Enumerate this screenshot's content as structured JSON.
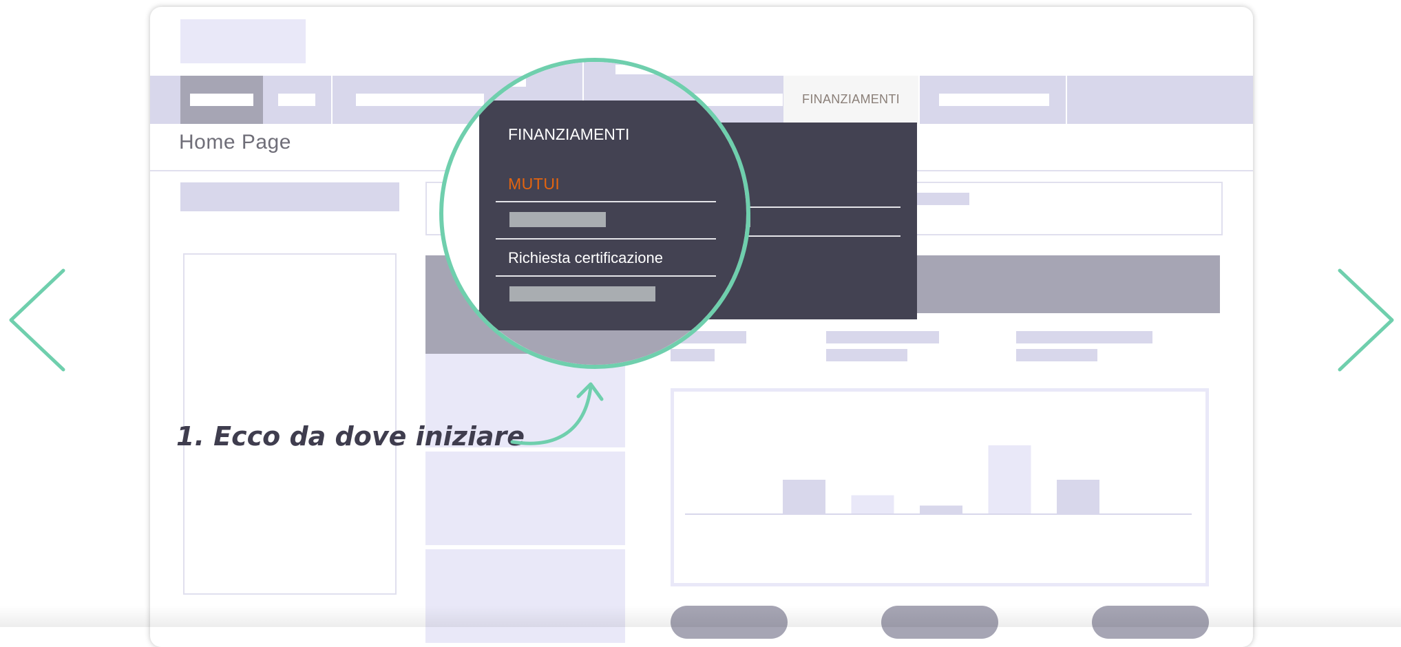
{
  "breadcrumb": {
    "title": "Home Page"
  },
  "nav": {
    "active_tab_label": "FINANZIAMENTI"
  },
  "mega_menu": {
    "heading": "FINANZIAMENTI",
    "items": [
      {
        "label": "MUTUI",
        "state": "highlighted"
      },
      {
        "label": ""
      },
      {
        "label": "Richiesta certificazione"
      },
      {
        "label": ""
      }
    ]
  },
  "callout": {
    "text": "1. Ecco da dove iniziare"
  },
  "chart_data": {
    "type": "bar",
    "categories": [
      "",
      "",
      "",
      "",
      ""
    ],
    "values": [
      2,
      1.1,
      0.5,
      4,
      2
    ]
  },
  "colors": {
    "accent_teal": "#6fcfad",
    "menu_dark": "#434252",
    "highlight_orange": "#e4640f",
    "placeholder_lavender": "#d8d7eb",
    "placeholder_gray": "#a6a5b4"
  },
  "icons": {
    "prev": "chevron-left-icon",
    "next": "chevron-right-icon",
    "arrow": "curved-arrow-icon"
  }
}
